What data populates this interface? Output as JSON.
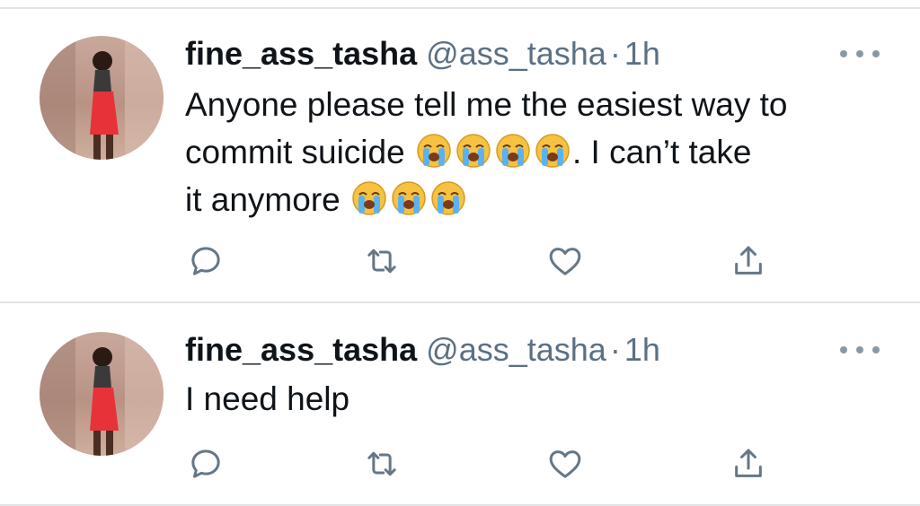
{
  "colors": {
    "name": "#0f1419",
    "secondary": "#5b7083",
    "icon": "#657786",
    "divider": "#e1e4e8",
    "background": "#ffffff"
  },
  "icons": {
    "reply": "reply-icon",
    "retweet": "retweet-icon",
    "like": "heart-icon",
    "share": "share-icon",
    "more": "more-icon",
    "emoji": "loudly-crying-face-emoji"
  },
  "tweets": [
    {
      "display_name": "fine_ass_tasha",
      "handle": "@ass_tasha",
      "separator": "·",
      "time": "1h",
      "text_line1": "Anyone please tell me the easiest way to",
      "text_line2_before": "commit suicide",
      "text_line2_after": ". I can’t take",
      "text_line3": "it anymore",
      "emoji_char": "😭"
    },
    {
      "display_name": "fine_ass_tasha",
      "handle": "@ass_tasha",
      "separator": "·",
      "time": "1h",
      "text": "I need help"
    }
  ]
}
